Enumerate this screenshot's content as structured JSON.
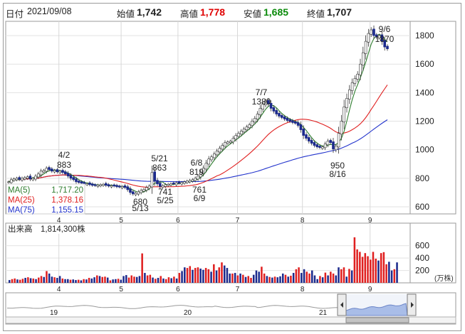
{
  "header": {
    "date_label": "日付",
    "date": "2021/09/08",
    "open_label": "始値",
    "open": "1,742",
    "high_label": "高値",
    "high": "1,778",
    "low_label": "安値",
    "low": "1,685",
    "close_label": "終値",
    "close": "1,707"
  },
  "colors": {
    "up": "#ffffff",
    "down": "#1c2a8c",
    "ma5": "#2e7d2e",
    "ma25": "#e02020",
    "ma75": "#2233cc",
    "high_text": "#e00000",
    "low_text": "#0a8a0a",
    "vol_up": "#e02020",
    "vol_down": "#1c2a8c",
    "overview_fill": "#a9bde8"
  },
  "legend": [
    {
      "label": "MA(5)",
      "value": "1,717.20",
      "color": "#2e7d2e"
    },
    {
      "label": "MA(25)",
      "value": "1,378.16",
      "color": "#e02020"
    },
    {
      "label": "MA(75)",
      "value": "1,155.15",
      "color": "#2233cc"
    }
  ],
  "annotations": [
    {
      "date": "4/2",
      "value": "883"
    },
    {
      "date": "5/21",
      "value": "863"
    },
    {
      "date": "6/8",
      "value": "819"
    },
    {
      "date": "7/7",
      "value": "1380"
    },
    {
      "date": "9/6",
      "value": "1870"
    },
    {
      "date": "5/13",
      "value": "680"
    },
    {
      "date": "5/25",
      "value": "741"
    },
    {
      "date": "6/9",
      "value": "761"
    },
    {
      "date": "8/16",
      "value": "950"
    }
  ],
  "volume_label": "出来高",
  "volume_value": "1,814,300株",
  "volume_unit": "(万株)",
  "overview_years": [
    "19",
    "20",
    "21"
  ],
  "chart_data": [
    {
      "type": "candlestick",
      "x_ticks": [
        "4",
        "5",
        "6",
        "7",
        "8",
        "9"
      ],
      "y_ticks": [
        600,
        800,
        1000,
        1200,
        1400,
        1600,
        1800
      ],
      "ylim": [
        550,
        1900
      ],
      "closes": [
        775,
        790,
        795,
        800,
        792,
        800,
        805,
        810,
        795,
        800,
        815,
        830,
        850,
        855,
        870,
        860,
        850,
        855,
        845,
        850,
        840,
        830,
        815,
        800,
        790,
        775,
        770,
        765,
        760,
        762,
        755,
        750,
        748,
        752,
        755,
        758,
        750,
        745,
        748,
        745,
        740,
        738,
        742,
        735,
        720,
        700,
        690,
        695,
        705,
        715,
        722,
        735,
        745,
        840,
        780,
        760,
        742,
        748,
        755,
        758,
        762,
        760,
        768,
        765,
        770,
        775,
        780,
        785,
        790,
        800,
        815,
        840,
        870,
        905,
        935,
        950,
        970,
        990,
        1010,
        1030,
        1050,
        1055,
        1060,
        1080,
        1100,
        1115,
        1130,
        1145,
        1160,
        1175,
        1200,
        1220,
        1250,
        1290,
        1320,
        1340,
        1320,
        1290,
        1270,
        1250,
        1235,
        1225,
        1215,
        1205,
        1198,
        1190,
        1185,
        1170,
        1140,
        1100,
        1080,
        1060,
        1045,
        1030,
        1020,
        1015,
        1020,
        1040,
        1060,
        1050,
        1005,
        1025,
        1115,
        1200,
        1300,
        1360,
        1420,
        1470,
        1500,
        1530,
        1600,
        1680,
        1760,
        1815,
        1840,
        1800,
        1790,
        1800,
        1760,
        1720,
        1707
      ],
      "volume_y_ticks": [
        200,
        400,
        600
      ],
      "volume_ylim": [
        0,
        780
      ],
      "volume": [
        [
          45,
          "d"
        ],
        [
          60,
          "u"
        ],
        [
          70,
          "u"
        ],
        [
          55,
          "d"
        ],
        [
          50,
          "u"
        ],
        [
          65,
          "u"
        ],
        [
          80,
          "d"
        ],
        [
          90,
          "u"
        ],
        [
          75,
          "d"
        ],
        [
          70,
          "u"
        ],
        [
          60,
          "d"
        ],
        [
          85,
          "u"
        ],
        [
          110,
          "u"
        ],
        [
          95,
          "d"
        ],
        [
          190,
          "u"
        ],
        [
          150,
          "d"
        ],
        [
          100,
          "d"
        ],
        [
          90,
          "u"
        ],
        [
          80,
          "d"
        ],
        [
          110,
          "d"
        ],
        [
          70,
          "u"
        ],
        [
          60,
          "d"
        ],
        [
          60,
          "d"
        ],
        [
          50,
          "u"
        ],
        [
          55,
          "d"
        ],
        [
          45,
          "d"
        ],
        [
          50,
          "u"
        ],
        [
          40,
          "d"
        ],
        [
          60,
          "u"
        ],
        [
          55,
          "d"
        ],
        [
          80,
          "u"
        ],
        [
          70,
          "d"
        ],
        [
          90,
          "d"
        ],
        [
          120,
          "u"
        ],
        [
          110,
          "d"
        ],
        [
          95,
          "u"
        ],
        [
          100,
          "u"
        ],
        [
          85,
          "d"
        ],
        [
          40,
          "u"
        ],
        [
          55,
          "d"
        ],
        [
          60,
          "d"
        ],
        [
          65,
          "u"
        ],
        [
          50,
          "d"
        ],
        [
          110,
          "d"
        ],
        [
          125,
          "d"
        ],
        [
          85,
          "u"
        ],
        [
          120,
          "u"
        ],
        [
          100,
          "u"
        ],
        [
          95,
          "d"
        ],
        [
          110,
          "d"
        ],
        [
          475,
          "u"
        ],
        [
          160,
          "d"
        ],
        [
          120,
          "u"
        ],
        [
          130,
          "u"
        ],
        [
          85,
          "d"
        ],
        [
          65,
          "u"
        ],
        [
          80,
          "d"
        ],
        [
          110,
          "u"
        ],
        [
          70,
          "d"
        ],
        [
          60,
          "u"
        ],
        [
          90,
          "u"
        ],
        [
          75,
          "d"
        ],
        [
          100,
          "u"
        ],
        [
          70,
          "d"
        ],
        [
          160,
          "u"
        ],
        [
          190,
          "d"
        ],
        [
          250,
          "d"
        ],
        [
          240,
          "u"
        ],
        [
          270,
          "u"
        ],
        [
          210,
          "d"
        ],
        [
          240,
          "u"
        ],
        [
          250,
          "u"
        ],
        [
          230,
          "d"
        ],
        [
          210,
          "d"
        ],
        [
          240,
          "u"
        ],
        [
          220,
          "u"
        ],
        [
          180,
          "d"
        ],
        [
          300,
          "u"
        ],
        [
          200,
          "d"
        ],
        [
          250,
          "u"
        ],
        [
          330,
          "u"
        ],
        [
          280,
          "d"
        ],
        [
          240,
          "d"
        ],
        [
          150,
          "d"
        ],
        [
          150,
          "u"
        ],
        [
          160,
          "d"
        ],
        [
          120,
          "u"
        ],
        [
          150,
          "d"
        ],
        [
          130,
          "u"
        ],
        [
          95,
          "d"
        ],
        [
          110,
          "u"
        ],
        [
          80,
          "u"
        ],
        [
          130,
          "d"
        ],
        [
          200,
          "d"
        ],
        [
          180,
          "d"
        ],
        [
          260,
          "u"
        ],
        [
          150,
          "u"
        ],
        [
          110,
          "d"
        ],
        [
          95,
          "u"
        ],
        [
          85,
          "d"
        ],
        [
          100,
          "u"
        ],
        [
          90,
          "d"
        ],
        [
          105,
          "d"
        ],
        [
          150,
          "d"
        ],
        [
          130,
          "u"
        ],
        [
          100,
          "d"
        ],
        [
          115,
          "u"
        ],
        [
          160,
          "d"
        ],
        [
          220,
          "u"
        ],
        [
          250,
          "u"
        ],
        [
          160,
          "d"
        ],
        [
          220,
          "d"
        ],
        [
          180,
          "u"
        ],
        [
          150,
          "u"
        ],
        [
          200,
          "d"
        ],
        [
          120,
          "d"
        ],
        [
          60,
          "d"
        ],
        [
          110,
          "u"
        ],
        [
          90,
          "d"
        ],
        [
          165,
          "u"
        ],
        [
          120,
          "d"
        ],
        [
          180,
          "u"
        ],
        [
          150,
          "u"
        ],
        [
          120,
          "d"
        ],
        [
          250,
          "d"
        ],
        [
          220,
          "u"
        ],
        [
          250,
          "u"
        ],
        [
          100,
          "d"
        ],
        [
          225,
          "u"
        ],
        [
          200,
          "d"
        ],
        [
          735,
          "u"
        ],
        [
          540,
          "u"
        ],
        [
          500,
          "u"
        ],
        [
          420,
          "u"
        ],
        [
          480,
          "u"
        ],
        [
          430,
          "u"
        ],
        [
          375,
          "u"
        ],
        [
          500,
          "u"
        ],
        [
          390,
          "u"
        ],
        [
          360,
          "d"
        ],
        [
          480,
          "u"
        ],
        [
          495,
          "u"
        ],
        [
          300,
          "u"
        ],
        [
          340,
          "d"
        ],
        [
          200,
          "d"
        ],
        [
          220,
          "u"
        ],
        [
          330,
          "d"
        ]
      ]
    }
  ]
}
